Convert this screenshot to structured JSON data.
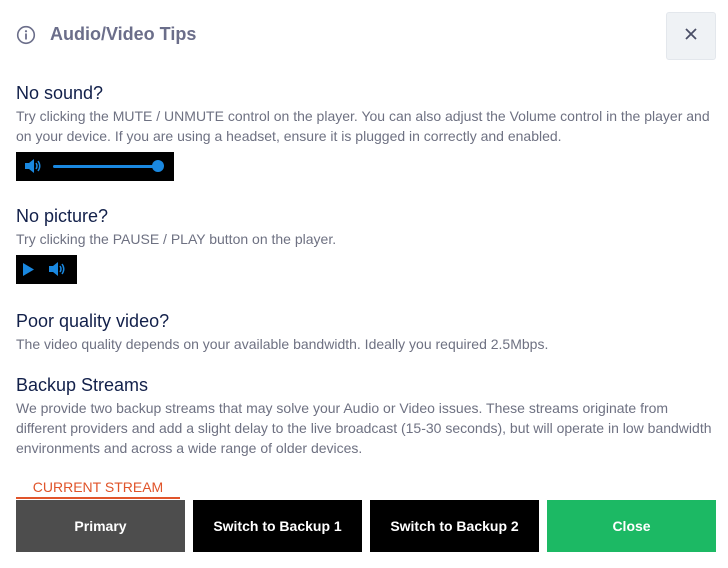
{
  "header": {
    "title": "Audio/Video Tips"
  },
  "sections": {
    "no_sound": {
      "heading": "No sound?",
      "text": "Try clicking the MUTE / UNMUTE control on the player. You can also adjust the Volume control in the player and on your device. If you are using a headset, ensure it is plugged in correctly and enabled."
    },
    "no_picture": {
      "heading": "No picture?",
      "text": "Try clicking the PAUSE / PLAY button on the player."
    },
    "poor_quality": {
      "heading": "Poor quality video?",
      "text": "The video quality depends on your available bandwidth. Ideally you required 2.5Mbps."
    },
    "backup": {
      "heading": "Backup Streams",
      "text": "We provide two backup streams that may solve your Audio or Video issues. These streams originate from different providers and add a slight delay to the live broadcast (15-30 seconds), but will operate in low bandwidth environments and across a wide range of older devices."
    }
  },
  "player": {
    "volume_level": 1.0,
    "accent_color": "#1a88e0"
  },
  "streams": {
    "current_label": "CURRENT STREAM",
    "primary_label": "Primary",
    "backup1_label": "Switch to Backup 1",
    "backup2_label": "Switch to Backup 2",
    "close_label": "Close"
  },
  "colors": {
    "accent_orange": "#e0542a",
    "close_green": "#1cb964",
    "primary_gray": "#4d4d4d"
  },
  "icons": {
    "info": "info-circle-icon",
    "close": "close-icon",
    "volume": "volume-icon",
    "play": "play-icon"
  }
}
